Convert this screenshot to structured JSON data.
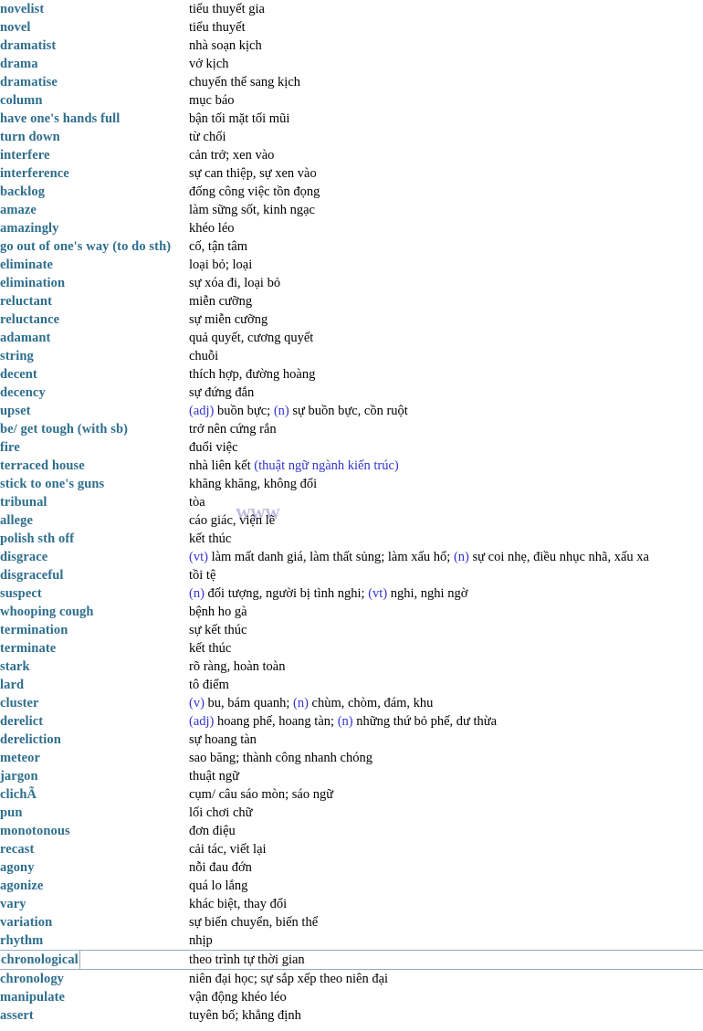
{
  "document": {
    "type": "vocabulary-glossary",
    "language_pair": "English - Vietnamese",
    "watermark": "WWW",
    "colors": {
      "term": "#2e6e8e",
      "definition": "#000000",
      "part_of_speech_marker": "#3333cc",
      "background": "#ffffff",
      "selection_border": "#8fa9bd"
    },
    "selected_row_index": 52
  },
  "rows": [
    {
      "term": "novelist",
      "definition": "tiểu thuyết gia"
    },
    {
      "term": "novel",
      "definition": "tiểu thuyết"
    },
    {
      "term": "dramatist",
      "definition": "nhà soạn kịch"
    },
    {
      "term": "drama",
      "definition": "vở kịch"
    },
    {
      "term": "dramatise",
      "definition": "chuyển thể sang kịch"
    },
    {
      "term": "column",
      "definition": "mục báo"
    },
    {
      "term": "have one's hands full",
      "definition": "bận tối mặt tối mũi"
    },
    {
      "term": "turn down",
      "definition": "từ chối"
    },
    {
      "term": "interfere",
      "definition": "cản trở; xen vào"
    },
    {
      "term": "interference",
      "definition": "sự can thiệp, sự xen vào"
    },
    {
      "term": "backlog",
      "definition": "đống công việc tồn đọng"
    },
    {
      "term": "amaze",
      "definition": "làm sững sốt, kinh ngạc"
    },
    {
      "term": "amazingly",
      "definition": "khéo léo"
    },
    {
      "term": "go out of one's way (to do sth)",
      "definition": "cố, tận tâm"
    },
    {
      "term": "eliminate",
      "definition": "loại bỏ; loại"
    },
    {
      "term": "elimination",
      "definition": "sự xóa đi, loại bỏ"
    },
    {
      "term": "reluctant",
      "definition": "miễn cưỡng"
    },
    {
      "term": "reluctance",
      "definition": "sự miễn cưỡng"
    },
    {
      "term": "adamant",
      "definition": "quả quyết, cương quyết"
    },
    {
      "term": "string",
      "definition": "chuỗi"
    },
    {
      "term": "decent",
      "definition": "thích hợp, đường hoàng"
    },
    {
      "term": "decency",
      "definition": "sự đứng đắn"
    },
    {
      "term": "upset",
      "definition_parts": [
        {
          "text": "(adj)",
          "style": "pos"
        },
        {
          "text": " buồn bực; ",
          "style": "plain"
        },
        {
          "text": "(n)",
          "style": "pos"
        },
        {
          "text": " sự buồn bực, cồn ruột",
          "style": "plain"
        }
      ]
    },
    {
      "term": "be/ get tough (with sb)",
      "definition": "trở nên cứng rắn"
    },
    {
      "term": "fire",
      "definition": "đuổi việc"
    },
    {
      "term": "terraced house",
      "definition_parts": [
        {
          "text": "nhà liên kết ",
          "style": "plain"
        },
        {
          "text": "(thuật ngữ ngành kiến trúc)",
          "style": "note"
        }
      ]
    },
    {
      "term": "stick to one's guns",
      "definition": "khăng khăng, không đổi"
    },
    {
      "term": "tribunal",
      "definition": "tòa"
    },
    {
      "term": "allege",
      "definition": "cáo giác, viện lẽ"
    },
    {
      "term": "polish sth off",
      "definition": "kết thúc"
    },
    {
      "term": "disgrace",
      "definition_parts": [
        {
          "text": "(vt)",
          "style": "pos"
        },
        {
          "text": " làm mất danh giá, làm thất sủng; làm xấu hổ; ",
          "style": "plain"
        },
        {
          "text": "(n)",
          "style": "pos"
        },
        {
          "text": " sự coi nhẹ, điều nhục nhã, xấu xa",
          "style": "plain"
        }
      ]
    },
    {
      "term": "disgraceful",
      "definition": "tồi tệ"
    },
    {
      "term": "suspect",
      "definition_parts": [
        {
          "text": "(n)",
          "style": "pos"
        },
        {
          "text": " đối tượng, người bị tình nghi; ",
          "style": "plain"
        },
        {
          "text": "(vt)",
          "style": "pos"
        },
        {
          "text": " nghi, nghi ngờ",
          "style": "plain"
        }
      ]
    },
    {
      "term": "whooping cough",
      "definition": "bệnh ho gà"
    },
    {
      "term": "termination",
      "definition": "sự kết thúc"
    },
    {
      "term": "terminate",
      "definition": "kết thúc"
    },
    {
      "term": "stark",
      "definition": "rõ ràng, hoàn toàn"
    },
    {
      "term": "lard",
      "definition": "tô điểm"
    },
    {
      "term": "cluster",
      "definition_parts": [
        {
          "text": "(v)",
          "style": "pos"
        },
        {
          "text": " bu, bám quanh; ",
          "style": "plain"
        },
        {
          "text": "(n)",
          "style": "pos"
        },
        {
          "text": " chùm, chòm, đám, khu",
          "style": "plain"
        }
      ]
    },
    {
      "term": "derelict",
      "definition_parts": [
        {
          "text": "(adj)",
          "style": "pos"
        },
        {
          "text": " hoang phế, hoang tàn; ",
          "style": "plain"
        },
        {
          "text": "(n)",
          "style": "pos"
        },
        {
          "text": " những thứ bỏ phế, dư thừa",
          "style": "plain"
        }
      ]
    },
    {
      "term": "dereliction",
      "definition": "sự hoang tàn"
    },
    {
      "term": "meteor",
      "definition": "sao băng; thành công nhanh chóng"
    },
    {
      "term": "jargon",
      "definition": "thuật ngữ"
    },
    {
      "term": "clichÃ",
      "definition": "cụm/ câu sáo mòn; sáo ngữ"
    },
    {
      "term": "pun",
      "definition": "lối chơi chữ"
    },
    {
      "term": "monotonous",
      "definition": "đơn điệu"
    },
    {
      "term": "recast",
      "definition": "cải tác, viết lại"
    },
    {
      "term": "agony",
      "definition": "nỗi đau đớn"
    },
    {
      "term": "agonize",
      "definition": "quá lo lắng"
    },
    {
      "term": "vary",
      "definition": "khác biệt, thay đổi"
    },
    {
      "term": "variation",
      "definition": "sự biến chuyển, biến thể"
    },
    {
      "term": "rhythm",
      "definition": "nhịp"
    },
    {
      "term": "chronological",
      "definition": "theo trình tự thời gian",
      "selected": true
    },
    {
      "term": "chronology",
      "definition": "niên đại học; sự sắp xếp theo niên đại"
    },
    {
      "term": "manipulate",
      "definition": "vận động khéo léo"
    },
    {
      "term": "assert",
      "definition": "tuyên bố; khẳng định"
    }
  ]
}
